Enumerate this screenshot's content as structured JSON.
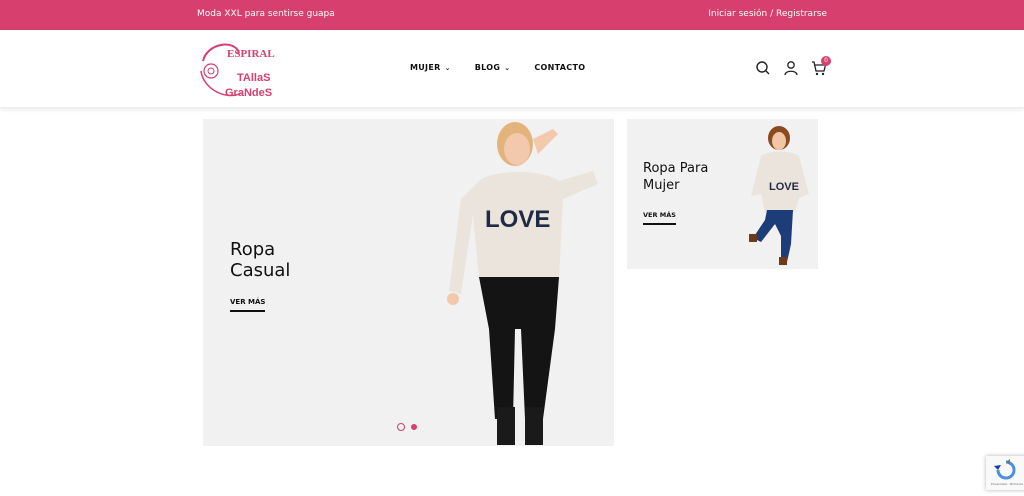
{
  "topbar": {
    "tagline": "Moda XXL para sentirse guapa",
    "login": "Iniciar sesión",
    "separator": "/",
    "register": "Registrarse"
  },
  "logo": {
    "line1": "ESPIRAL",
    "line2": "TAllaS",
    "line3": "GraNdeS",
    "color": "#d63f6e"
  },
  "nav": {
    "items": [
      {
        "label": "MUJER",
        "has_dropdown": true
      },
      {
        "label": "BLOG",
        "has_dropdown": true
      },
      {
        "label": "CONTACTO",
        "has_dropdown": false
      }
    ]
  },
  "header_icons": {
    "search": "search-icon",
    "account": "user-icon",
    "cart": "cart-icon",
    "cart_count": "0"
  },
  "hero": {
    "title": "Ropa\nCasual",
    "cta": "VER MÁS",
    "slides": 2,
    "active_slide": 2,
    "shirt_text": "LOVE"
  },
  "promo": {
    "title": "Ropa Para\nMujer",
    "cta": "VER MÁS",
    "shirt_text": "LOVE"
  },
  "recaptcha": {
    "label": "Privacidad - Términos"
  },
  "colors": {
    "brand": "#d63f6e",
    "panel": "#f1f1f1"
  }
}
